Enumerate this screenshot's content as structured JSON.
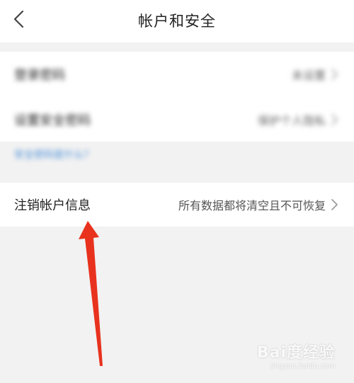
{
  "header": {
    "title": "帐户和安全",
    "back_icon": "chevron-left-icon"
  },
  "settings": [
    {
      "label": "登录密码",
      "value": "未设置"
    },
    {
      "label": "设置安全密码",
      "value": "保护个人隐私"
    }
  ],
  "hint": {
    "text": "安全密码是什么？"
  },
  "deactivate": {
    "label": "注销帐户信息",
    "value": "所有数据都将清空且不可恢复"
  },
  "watermark": {
    "main": "Bai度经验",
    "sub": "jingyan.baidu.com"
  },
  "colors": {
    "annotation_arrow": "#e8321e",
    "link": "#4a8fd8",
    "background": "#f2f2f2"
  }
}
